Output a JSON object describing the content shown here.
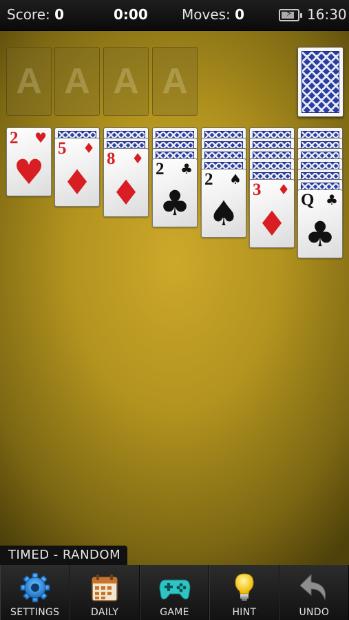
{
  "status": {
    "score_label": "Score:",
    "score_value": "0",
    "timer": "0:00",
    "moves_label": "Moves:",
    "moves_value": "0",
    "clock": "16:30"
  },
  "foundations": [
    "A",
    "A",
    "A",
    "A"
  ],
  "tableau": [
    {
      "face_down": 0,
      "rank": "2",
      "suit": "♥",
      "color": "red"
    },
    {
      "face_down": 1,
      "rank": "5",
      "suit": "♦",
      "color": "red"
    },
    {
      "face_down": 2,
      "rank": "8",
      "suit": "♦",
      "color": "red"
    },
    {
      "face_down": 3,
      "rank": "2",
      "suit": "♣",
      "color": "black"
    },
    {
      "face_down": 4,
      "rank": "2",
      "suit": "♠",
      "color": "black"
    },
    {
      "face_down": 5,
      "rank": "3",
      "suit": "♦",
      "color": "red"
    },
    {
      "face_down": 6,
      "rank": "Q",
      "suit": "♣",
      "color": "black"
    }
  ],
  "mode_label": "TIMED - RANDOM",
  "toolbar": {
    "settings": "SETTINGS",
    "daily": "DAILY",
    "game": "GAME",
    "hint": "HINT",
    "undo": "UNDO"
  },
  "icons": {
    "settings": "gear-icon",
    "daily": "calendar-icon",
    "game": "gamepad-icon",
    "hint": "lightbulb-icon",
    "undo": "undo-arrow-icon"
  }
}
